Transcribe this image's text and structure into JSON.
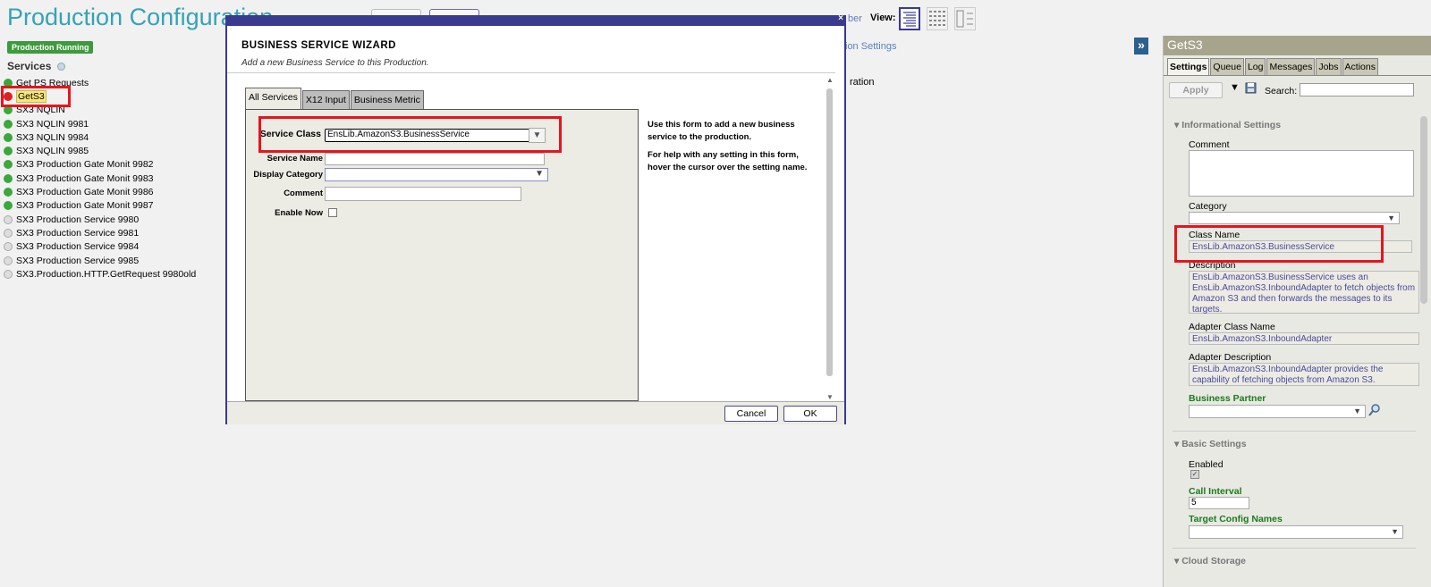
{
  "header": {
    "title": "Production Configuration",
    "top_link": "ber",
    "view_label": "View:"
  },
  "status": {
    "badge": "Production Running"
  },
  "services": {
    "heading": "Services",
    "items": [
      {
        "name": "Get PS Requests",
        "status": "green"
      },
      {
        "name": "GetS3",
        "status": "red"
      },
      {
        "name": "SX3 NQLIN",
        "status": "green"
      },
      {
        "name": "SX3 NQLIN 9981",
        "status": "green"
      },
      {
        "name": "SX3 NQLIN 9984",
        "status": "green"
      },
      {
        "name": "SX3 NQLIN 9985",
        "status": "green"
      },
      {
        "name": "SX3 Production Gate Monit 9982",
        "status": "green"
      },
      {
        "name": "SX3 Production Gate Monit 9983",
        "status": "green"
      },
      {
        "name": "SX3 Production Gate Monit 9986",
        "status": "green"
      },
      {
        "name": "SX3 Production Gate Monit 9987",
        "status": "green"
      },
      {
        "name": "SX3 Production Service 9980",
        "status": "grey"
      },
      {
        "name": "SX3 Production Service 9981",
        "status": "grey"
      },
      {
        "name": "SX3 Production Service 9984",
        "status": "grey"
      },
      {
        "name": "SX3 Production Service 9985",
        "status": "grey"
      },
      {
        "name": "SX3.Production.HTTP.GetRequest 9980old",
        "status": "grey"
      }
    ]
  },
  "main": {
    "settings_link": "ion Settings",
    "operation_text": "ration",
    "expand_label": "»"
  },
  "dialog": {
    "close": "×",
    "title": "BUSINESS SERVICE WIZARD",
    "subtitle": "Add a new Business Service to this Production.",
    "tabs": [
      "All Services",
      "X12 Input",
      "Business Metric"
    ],
    "fields": {
      "service_class_label": "Service Class",
      "service_class_value": "EnsLib.AmazonS3.BusinessService",
      "service_name_label": "Service Name",
      "display_category_label": "Display Category",
      "comment_label": "Comment",
      "enable_now_label": "Enable Now"
    },
    "help": [
      "Use this form to add a new business service to the production.",
      "For help with any setting in this form, hover the cursor over the setting name."
    ],
    "cancel_label": "Cancel",
    "ok_label": "OK"
  },
  "right_panel": {
    "title": "GetS3",
    "tabs": [
      "Settings",
      "Queue",
      "Log",
      "Messages",
      "Jobs",
      "Actions"
    ],
    "apply_label": "Apply",
    "search_label": "Search:",
    "informational": {
      "heading": "Informational Settings",
      "comment_label": "Comment",
      "category_label": "Category",
      "class_name_label": "Class Name",
      "class_name_value": "EnsLib.AmazonS3.BusinessService",
      "description_label": "Description",
      "description_value": "EnsLib.AmazonS3.BusinessService uses an EnsLib.AmazonS3.InboundAdapter to fetch objects from Amazon S3 and then forwards the messages to its targets.",
      "adapter_class_label": "Adapter Class Name",
      "adapter_class_value": "EnsLib.AmazonS3.InboundAdapter",
      "adapter_desc_label": "Adapter Description",
      "adapter_desc_value": "EnsLib.AmazonS3.InboundAdapter provides the capability of fetching objects from Amazon S3.",
      "business_partner_label": "Business Partner"
    },
    "basic": {
      "heading": "Basic Settings",
      "enabled_label": "Enabled",
      "call_interval_label": "Call Interval",
      "call_interval_value": "5",
      "target_config_label": "Target Config Names"
    },
    "cloud_heading": "Cloud Storage"
  }
}
